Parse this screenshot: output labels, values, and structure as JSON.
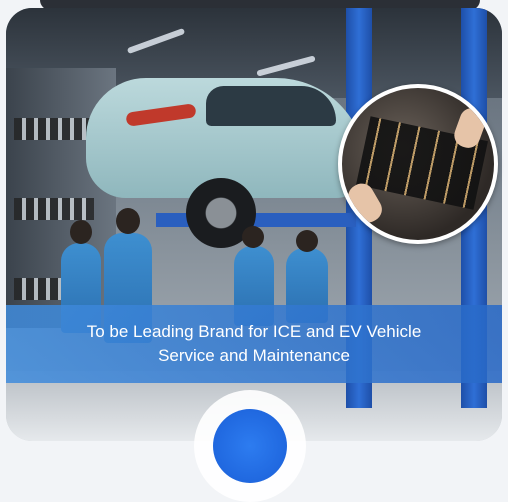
{
  "banner": {
    "line1": "To be Leading Brand for ICE and EV Vehicle",
    "line2": "Service and Maintenance"
  },
  "image": {
    "description_icon": "workshop-photo",
    "inset_icon": "ev-battery-photo"
  },
  "colors": {
    "banner": "#2f6fd6",
    "banner_text": "#ffffff",
    "bubble": "#1a5fd8"
  }
}
